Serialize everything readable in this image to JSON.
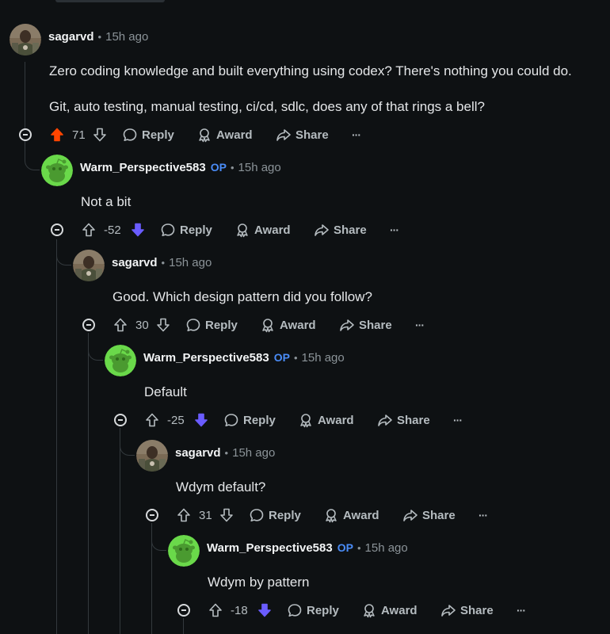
{
  "colors": {
    "upvoted": "#ff4500",
    "downvoted": "#6a5cff",
    "op": "#4a8cf7",
    "bg": "#0e1113"
  },
  "actions": {
    "reply": "Reply",
    "award": "Award",
    "share": "Share",
    "more": "···"
  },
  "comments": [
    {
      "author": "sagarvd",
      "op": "",
      "time": "15h ago",
      "lines": [
        "Zero coding knowledge and built everything using codex? There's nothing you could do.",
        "Git, auto testing, manual testing, ci/cd, sdlc, does any of that rings a bell?"
      ],
      "score": "71",
      "vote": "up",
      "avatar": "photo"
    },
    {
      "author": "Warm_Perspective583",
      "op": "OP",
      "time": "15h ago",
      "lines": [
        "Not a bit"
      ],
      "score": "-52",
      "vote": "down",
      "avatar": "snoo"
    },
    {
      "author": "sagarvd",
      "op": "",
      "time": "15h ago",
      "lines": [
        "Good. Which design pattern did you follow?"
      ],
      "score": "30",
      "vote": "none",
      "avatar": "photo"
    },
    {
      "author": "Warm_Perspective583",
      "op": "OP",
      "time": "15h ago",
      "lines": [
        "Default"
      ],
      "score": "-25",
      "vote": "down",
      "avatar": "snoo"
    },
    {
      "author": "sagarvd",
      "op": "",
      "time": "15h ago",
      "lines": [
        "Wdym default?"
      ],
      "score": "31",
      "vote": "none",
      "avatar": "photo"
    },
    {
      "author": "Warm_Perspective583",
      "op": "OP",
      "time": "15h ago",
      "lines": [
        "Wdym by pattern"
      ],
      "score": "-18",
      "vote": "down",
      "avatar": "snoo"
    }
  ]
}
